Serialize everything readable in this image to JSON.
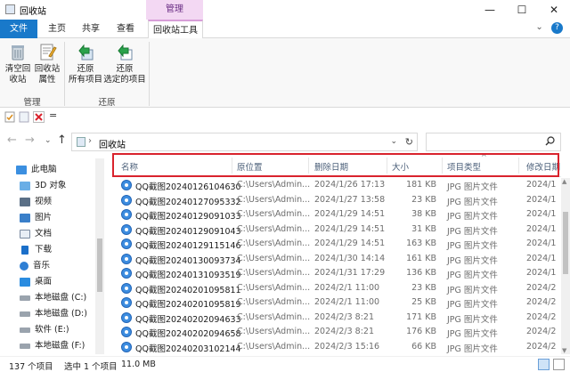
{
  "window": {
    "title": "回收站",
    "context_tab": "管理",
    "minimize": "—",
    "maximize": "☐",
    "close": "✕"
  },
  "tabs": [
    {
      "label": "文件"
    },
    {
      "label": "主页"
    },
    {
      "label": "共享"
    },
    {
      "label": "查看"
    },
    {
      "label": "回收站工具"
    }
  ],
  "tab_extra": {
    "chevron": "⌄"
  },
  "ribbon": {
    "buttons": [
      {
        "line1": "清空回",
        "line2": "收站"
      },
      {
        "line1": "回收站",
        "line2": "属性"
      },
      {
        "line1": "还原",
        "line2": "所有项目"
      },
      {
        "line1": "还原",
        "line2": "选定的项目"
      }
    ],
    "groups": [
      {
        "label": "管理"
      },
      {
        "label": "还原"
      }
    ]
  },
  "qat": {
    "dropdown": "="
  },
  "address": {
    "back": "←",
    "forward": "→",
    "recent": "⌄",
    "up": "↑",
    "separator": "›",
    "crumb": "回收站",
    "dropdown": "⌄",
    "refresh": "↻"
  },
  "search": {
    "placeholder": ""
  },
  "nav": {
    "items": [
      {
        "label": "此电脑"
      },
      {
        "label": "3D 对象"
      },
      {
        "label": "视频"
      },
      {
        "label": "图片"
      },
      {
        "label": "文档"
      },
      {
        "label": "下载"
      },
      {
        "label": "音乐"
      },
      {
        "label": "桌面"
      },
      {
        "label": "本地磁盘 (C:)"
      },
      {
        "label": "本地磁盘 (D:)"
      },
      {
        "label": "软件 (E:)"
      },
      {
        "label": "本地磁盘 (F:)"
      }
    ]
  },
  "columns": {
    "name": "名称",
    "orig": "原位置",
    "deleted": "删除日期",
    "size": "大小",
    "type": "项目类型",
    "modified": "修改日期"
  },
  "sort_caret": "^",
  "rows": [
    {
      "name": "QQ截图20240126104630",
      "orig": "C:\\Users\\Admin...",
      "deleted": "2024/1/26 17:13",
      "size": "181 KB",
      "type": "JPG 图片文件",
      "modified": "2024/1"
    },
    {
      "name": "QQ截图20240127095332",
      "orig": "C:\\Users\\Admin...",
      "deleted": "2024/1/27 13:58",
      "size": "23 KB",
      "type": "JPG 图片文件",
      "modified": "2024/1"
    },
    {
      "name": "QQ截图20240129091033",
      "orig": "C:\\Users\\Admin...",
      "deleted": "2024/1/29 14:51",
      "size": "38 KB",
      "type": "JPG 图片文件",
      "modified": "2024/1"
    },
    {
      "name": "QQ截图20240129091043",
      "orig": "C:\\Users\\Admin...",
      "deleted": "2024/1/29 14:51",
      "size": "31 KB",
      "type": "JPG 图片文件",
      "modified": "2024/1"
    },
    {
      "name": "QQ截图20240129115146",
      "orig": "C:\\Users\\Admin...",
      "deleted": "2024/1/29 14:51",
      "size": "163 KB",
      "type": "JPG 图片文件",
      "modified": "2024/1"
    },
    {
      "name": "QQ截图20240130093734",
      "orig": "C:\\Users\\Admin...",
      "deleted": "2024/1/30 14:14",
      "size": "161 KB",
      "type": "JPG 图片文件",
      "modified": "2024/1"
    },
    {
      "name": "QQ截图20240131093519",
      "orig": "C:\\Users\\Admin...",
      "deleted": "2024/1/31 17:29",
      "size": "136 KB",
      "type": "JPG 图片文件",
      "modified": "2024/1"
    },
    {
      "name": "QQ截图20240201095811",
      "orig": "C:\\Users\\Admin...",
      "deleted": "2024/2/1 11:00",
      "size": "23 KB",
      "type": "JPG 图片文件",
      "modified": "2024/2"
    },
    {
      "name": "QQ截图20240201095819",
      "orig": "C:\\Users\\Admin...",
      "deleted": "2024/2/1 11:00",
      "size": "25 KB",
      "type": "JPG 图片文件",
      "modified": "2024/2"
    },
    {
      "name": "QQ截图20240202094633",
      "orig": "C:\\Users\\Admin...",
      "deleted": "2024/2/3 8:21",
      "size": "171 KB",
      "type": "JPG 图片文件",
      "modified": "2024/2"
    },
    {
      "name": "QQ截图20240202094658",
      "orig": "C:\\Users\\Admin...",
      "deleted": "2024/2/3 8:21",
      "size": "176 KB",
      "type": "JPG 图片文件",
      "modified": "2024/2"
    },
    {
      "name": "QQ截图20240203102144",
      "orig": "C:\\Users\\Admin...",
      "deleted": "2024/2/3 15:16",
      "size": "66 KB",
      "type": "JPG 图片文件",
      "modified": "2024/2"
    }
  ],
  "status": {
    "count": "137 个项目",
    "selected": "选中 1 个项目",
    "size": "11.0 MB"
  },
  "colors": {
    "accent": "#1979ca",
    "context_tab": "#f3d8f3",
    "highlight_box": "#d9232d"
  }
}
